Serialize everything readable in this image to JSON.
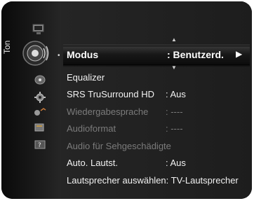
{
  "sidebar": {
    "section_label": "Ton",
    "icons": [
      "picture-icon",
      "sound-icon",
      "channel-icon",
      "setup-icon",
      "input-icon",
      "application-icon",
      "support-icon"
    ]
  },
  "menu": {
    "selected": {
      "label": "Modus",
      "value": ": Benutzerd."
    },
    "items": [
      {
        "label": "Equalizer",
        "value": ""
      },
      {
        "label": "SRS TruSurround HD",
        "value": ": Aus"
      },
      {
        "label": "Wiedergabesprache",
        "value": ": ----"
      },
      {
        "label": "Audioformat",
        "value": ": ----"
      },
      {
        "label": "Audio für Sehgeschädigte",
        "value": ""
      },
      {
        "label": "Auto. Lautst.",
        "value": ": Aus"
      },
      {
        "label": "Lautsprecher auswählen",
        "value": ": TV-Lautsprecher"
      }
    ]
  },
  "colors": {
    "text": "#f2f2f2",
    "disabled": "#7b7b7b",
    "background": "#1f1f1f"
  }
}
